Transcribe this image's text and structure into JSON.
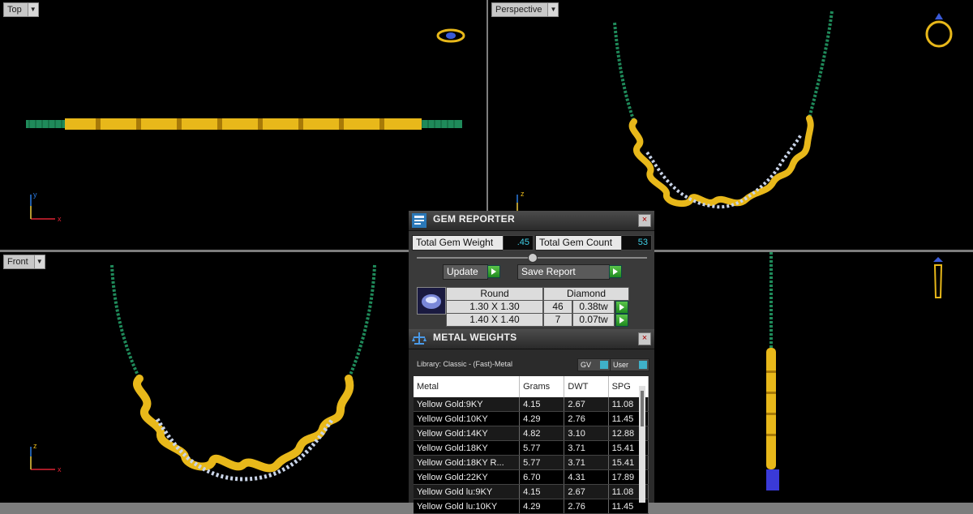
{
  "viewports": {
    "top": {
      "label": "Top",
      "axis_h": "x",
      "axis_v": "y"
    },
    "perspective": {
      "label": "Perspective",
      "axis_v": "z"
    },
    "front": {
      "label": "Front",
      "axis_h": "x",
      "axis_v": "z"
    }
  },
  "gem_reporter": {
    "title": "GEM REPORTER",
    "close": "×",
    "total_weight_label": "Total Gem Weight",
    "total_weight_value": ".45",
    "total_count_label": "Total Gem Count",
    "total_count_value": "53",
    "update_label": "Update",
    "save_report_label": "Save Report",
    "gem_cut": "Round",
    "gem_type": "Diamond",
    "rows": [
      {
        "size": "1.30 X 1.30",
        "count": "46",
        "weight": "0.38tw"
      },
      {
        "size": "1.40 X 1.40",
        "count": "7",
        "weight": "0.07tw"
      }
    ]
  },
  "metal_weights": {
    "title": "METAL WEIGHTS",
    "close": "×",
    "library": "Library: Classic - (Fast)-Metal",
    "gv_label": "GV",
    "user_label": "User",
    "columns": [
      "Metal",
      "Grams",
      "DWT",
      "SPG"
    ],
    "rows": [
      [
        "Yellow Gold:9KY",
        "4.15",
        "2.67",
        "11.08"
      ],
      [
        "Yellow Gold:10KY",
        "4.29",
        "2.76",
        "11.45"
      ],
      [
        "Yellow Gold:14KY",
        "4.82",
        "3.10",
        "12.88"
      ],
      [
        "Yellow Gold:18KY",
        "5.77",
        "3.71",
        "15.41"
      ],
      [
        "Yellow Gold:18KY R...",
        "5.77",
        "3.71",
        "15.41"
      ],
      [
        "Yellow Gold:22KY",
        "6.70",
        "4.31",
        "17.89"
      ],
      [
        "Yellow Gold lu:9KY",
        "4.15",
        "2.67",
        "11.08"
      ],
      [
        "Yellow Gold lu:10KY",
        "4.29",
        "2.76",
        "11.45"
      ]
    ]
  },
  "colors": {
    "gold": "#e8b81a",
    "chain": "#1f8a5a",
    "diamond": "#c9d4e8",
    "cyan_value": "#3fd0e8"
  }
}
